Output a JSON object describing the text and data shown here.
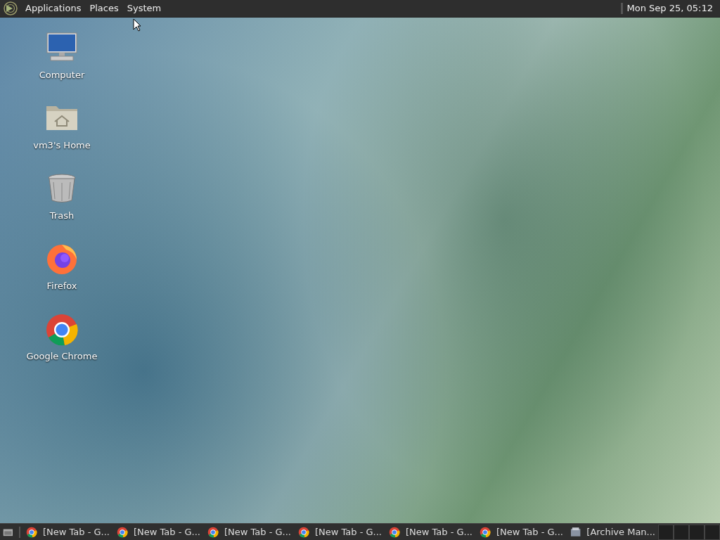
{
  "top_panel": {
    "menus": [
      "Applications",
      "Places",
      "System"
    ],
    "clock": "Mon Sep 25, 05:12"
  },
  "desktop_icons": [
    {
      "kind": "computer",
      "label": "Computer"
    },
    {
      "kind": "home",
      "label": "vm3's Home"
    },
    {
      "kind": "trash",
      "label": "Trash"
    },
    {
      "kind": "firefox",
      "label": "Firefox"
    },
    {
      "kind": "chrome",
      "label": "Google Chrome"
    }
  ],
  "taskbar": {
    "windows": [
      {
        "kind": "chrome",
        "label": "[New Tab - G..."
      },
      {
        "kind": "chrome",
        "label": "[New Tab - G..."
      },
      {
        "kind": "chrome",
        "label": "[New Tab - G..."
      },
      {
        "kind": "chrome",
        "label": "[New Tab - G..."
      },
      {
        "kind": "chrome",
        "label": "[New Tab - G..."
      },
      {
        "kind": "chrome",
        "label": "[New Tab - G..."
      },
      {
        "kind": "archive",
        "label": "[Archive Man..."
      }
    ]
  }
}
